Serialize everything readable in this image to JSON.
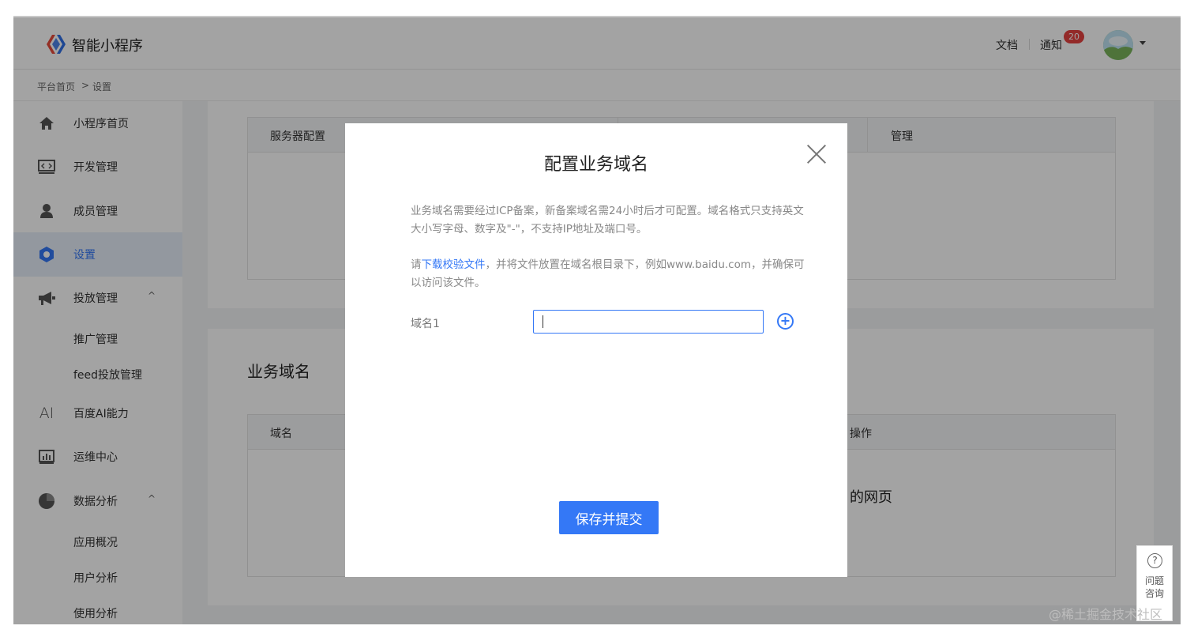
{
  "header": {
    "app_title": "智能小程序",
    "docs_label": "文档",
    "notice_label": "通知",
    "notice_count": "20"
  },
  "breadcrumb": {
    "home": "平台首页",
    "separator": ">",
    "current": "设置"
  },
  "sidebar": {
    "items": [
      {
        "label": "小程序首页",
        "icon": "home-icon"
      },
      {
        "label": "开发管理",
        "icon": "code-icon"
      },
      {
        "label": "成员管理",
        "icon": "user-icon"
      },
      {
        "label": "设置",
        "icon": "settings-icon",
        "active": true
      },
      {
        "label": "投放管理",
        "icon": "megaphone-icon",
        "caret": "^"
      },
      {
        "label": "百度AI能力",
        "icon": "ai-icon"
      },
      {
        "label": "运维中心",
        "icon": "bar-chart-icon"
      },
      {
        "label": "数据分析",
        "icon": "pie-chart-icon",
        "caret": "^"
      }
    ],
    "sub_items": {
      "promotion": [
        "推广管理",
        "feed投放管理"
      ],
      "analytics": [
        "应用概况",
        "用户分析",
        "使用分析"
      ]
    },
    "ai_glyph": "AI"
  },
  "main": {
    "server_table": {
      "col1": "服务器配置",
      "col_manage": "管理"
    },
    "business_domain": {
      "title": "业务域名",
      "col1": "域名",
      "col_actions": "操作",
      "empty_text": "的网页"
    }
  },
  "modal": {
    "title": "配置业务域名",
    "para1": "业务域名需要经过ICP备案，新备案域名需24小时后才可配置。域名格式只支持英文大小写字母、数字及\"-\"，不支持IP地址及端口号。",
    "para2_prefix": "请",
    "para2_link": "下载校验文件",
    "para2_rest": "，并将文件放置在域名根目录下，例如www.baidu.com，并确保可以访问该文件。",
    "field_label": "域名1",
    "field_value": "",
    "submit_label": "保存并提交"
  },
  "help_widget": {
    "icon_glyph": "?",
    "label": "问题咨询"
  },
  "watermark": "@稀土掘金技术社区",
  "colors": {
    "accent": "#3478f6",
    "badge": "#e64340",
    "overlay": "rgba(0,0,0,0.36)"
  }
}
